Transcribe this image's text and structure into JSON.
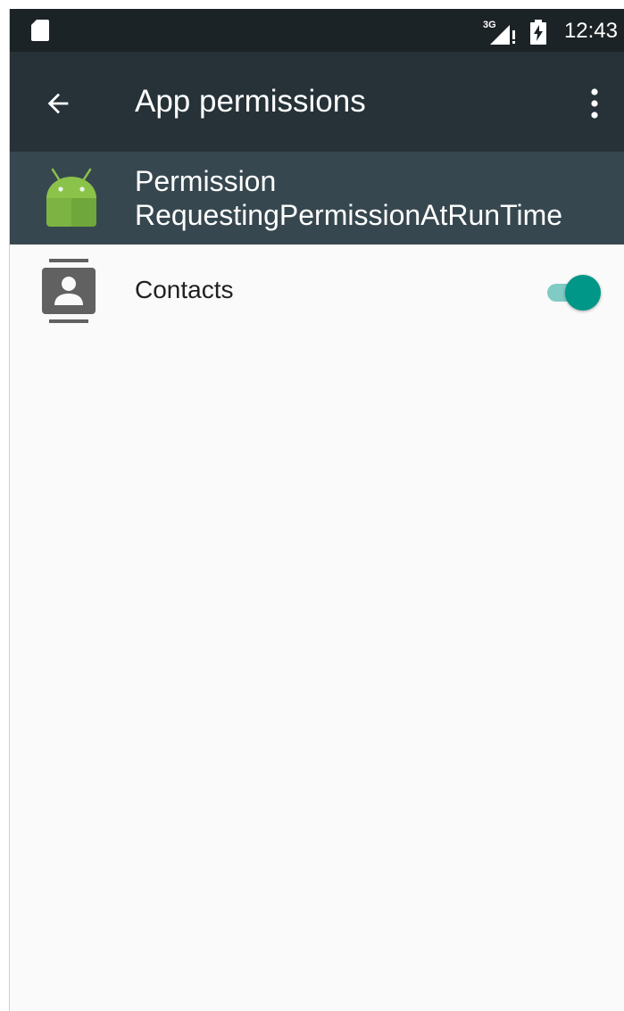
{
  "status_bar": {
    "network": "3G",
    "time": "12:43"
  },
  "toolbar": {
    "title": "App permissions",
    "back_icon": "arrow-back-icon",
    "more_icon": "more-vert-icon"
  },
  "app": {
    "name_line1": "Permission",
    "name_line2": "RequestingPermissionAtRunTime",
    "icon": "android-icon"
  },
  "permissions": [
    {
      "label": "Contacts",
      "icon": "contacts-icon",
      "enabled": true
    }
  ],
  "colors": {
    "status_bar": "#1c2326",
    "toolbar": "#263238",
    "app_header": "#37474f",
    "background": "#fafafa",
    "accent": "#009688",
    "android_green": "#8bc34a"
  }
}
